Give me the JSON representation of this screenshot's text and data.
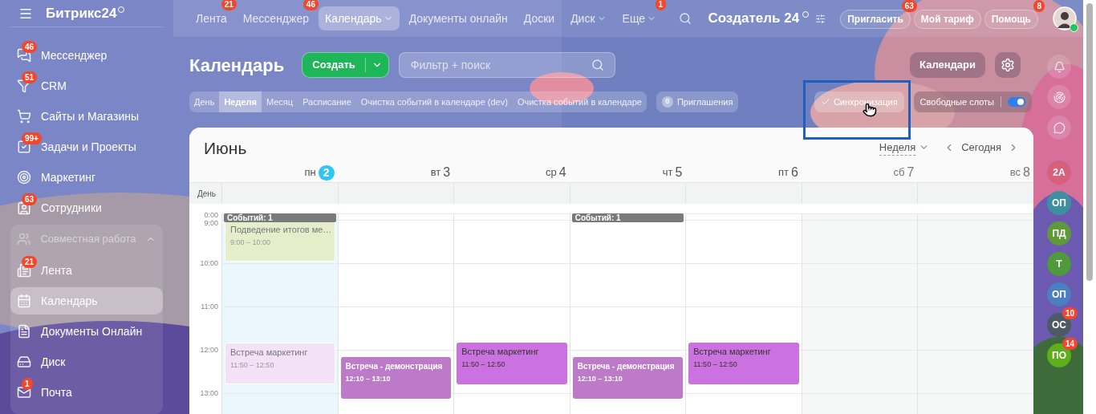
{
  "sidebar": {
    "title": "Битрикс24",
    "items": [
      {
        "label": "Мессенджер",
        "badge": "46"
      },
      {
        "label": "CRM",
        "badge": "51"
      },
      {
        "label": "Сайты и Магазины"
      },
      {
        "label": "Задачи и Проекты",
        "badge": "99+"
      },
      {
        "label": "Маркетинг"
      },
      {
        "label": "Сотрудники",
        "badge": "63"
      }
    ],
    "group": {
      "label": "Совместная работа",
      "expanded": true,
      "items": [
        {
          "label": "Лента",
          "badge": "21",
          "selected": false
        },
        {
          "label": "Календарь",
          "selected": true
        },
        {
          "label": "Документы Онлайн",
          "selected": false
        },
        {
          "label": "Диск",
          "selected": false
        },
        {
          "label": "Почта",
          "badge": "1",
          "selected": false
        }
      ]
    }
  },
  "topnav": {
    "items": [
      {
        "label": "Лента",
        "badge": "21",
        "selected": false,
        "dropdown": false
      },
      {
        "label": "Мессенджер",
        "badge": "46",
        "selected": false,
        "dropdown": false
      },
      {
        "label": "Календарь",
        "selected": true,
        "dropdown": true
      },
      {
        "label": "Документы онлайн",
        "selected": false,
        "dropdown": false
      },
      {
        "label": "Доски",
        "selected": false,
        "dropdown": false
      },
      {
        "label": "Диск",
        "selected": false,
        "dropdown": true
      },
      {
        "label": "Еще",
        "badge": "1",
        "selected": false,
        "dropdown": true
      }
    ],
    "company": "Создатель 24",
    "buttons": [
      {
        "label": "Пригласить",
        "badge": "63"
      },
      {
        "label": "Мой тариф"
      },
      {
        "label": "Помощь",
        "badge": "8"
      }
    ]
  },
  "page": {
    "title": "Календарь",
    "create": "Создать",
    "search_placeholder": "Фильтр + поиск",
    "calendars": "Календари"
  },
  "view_tabs": [
    {
      "label": "День",
      "selected": false
    },
    {
      "label": "Неделя",
      "selected": true
    },
    {
      "label": "Месяц",
      "selected": false
    },
    {
      "label": "Расписание",
      "selected": false
    },
    {
      "label": "Очистка событий в календаре (dev)",
      "selected": false
    },
    {
      "label": "Очистка событий в календаре",
      "selected": false
    }
  ],
  "invitations": {
    "count": "0",
    "label": "Приглашения"
  },
  "sync": {
    "label": "Синхронизация",
    "checked": true
  },
  "free_slots": {
    "label": "Свободные слоты",
    "on": true
  },
  "calendar": {
    "month": "Июнь",
    "view": "Неделя",
    "today": "Сегодня",
    "allday": "День",
    "days": [
      {
        "weekday": "пн",
        "day": "2",
        "today": true,
        "weekend": false
      },
      {
        "weekday": "вт",
        "day": "3",
        "today": false,
        "weekend": false
      },
      {
        "weekday": "ср",
        "day": "4",
        "today": false,
        "weekend": false
      },
      {
        "weekday": "чт",
        "day": "5",
        "today": false,
        "weekend": false
      },
      {
        "weekday": "пт",
        "day": "6",
        "today": false,
        "weekend": false
      },
      {
        "weekday": "сб",
        "day": "7",
        "today": false,
        "weekend": true
      },
      {
        "weekday": "вс",
        "day": "8",
        "today": false,
        "weekend": true
      }
    ],
    "time_labels": [
      "0:00",
      "9:00",
      "10:00",
      "11:00",
      "12:00",
      "13:00"
    ],
    "columns": [
      {
        "collapsed": "Событий: 1",
        "events": [
          {
            "title": "Подведение итогов ме…",
            "time": "9:00 – 10:00",
            "color": "#e6edcb",
            "past": true,
            "bold": false
          },
          {
            "title": "Встреча маркетинг",
            "time": "11:50 – 12:50",
            "color": "#f3e1f7",
            "past": true,
            "bold": false
          }
        ]
      },
      {
        "events": [
          {
            "title": "Встреча - демонстрация",
            "time": "12:10 – 13:10",
            "color": "#bd7ac8",
            "past": false,
            "bold": true
          }
        ]
      },
      {
        "events": [
          {
            "title": "Встреча маркетинг",
            "time": "11:50 – 12:50",
            "color": "#cc72e0",
            "past": false,
            "bold": false
          }
        ]
      },
      {
        "collapsed": "Событий: 1",
        "events": [
          {
            "title": "Встреча - демонстрация",
            "time": "12:10 – 13:10",
            "color": "#bd7ac8",
            "past": false,
            "bold": true
          }
        ]
      },
      {
        "events": [
          {
            "title": "Встреча маркетинг",
            "time": "11:50 – 12:50",
            "color": "#cc72e0",
            "past": false,
            "bold": false
          }
        ]
      }
    ]
  },
  "rail": {
    "avatars": [
      {
        "initials": "2А",
        "color": "#d9607c"
      },
      {
        "initials": "ОП",
        "color": "#3f8fa0"
      },
      {
        "initials": "ПД",
        "color": "#5f9a3a"
      },
      {
        "initials": "Т",
        "color": "#4f9a3a"
      },
      {
        "initials": "ОП",
        "color": "#4c7fbf"
      },
      {
        "initials": "ОС",
        "color": "#4e5a63",
        "badge": "10"
      },
      {
        "initials": "ПО",
        "color": "#5fae1c",
        "badge": "14"
      }
    ]
  }
}
